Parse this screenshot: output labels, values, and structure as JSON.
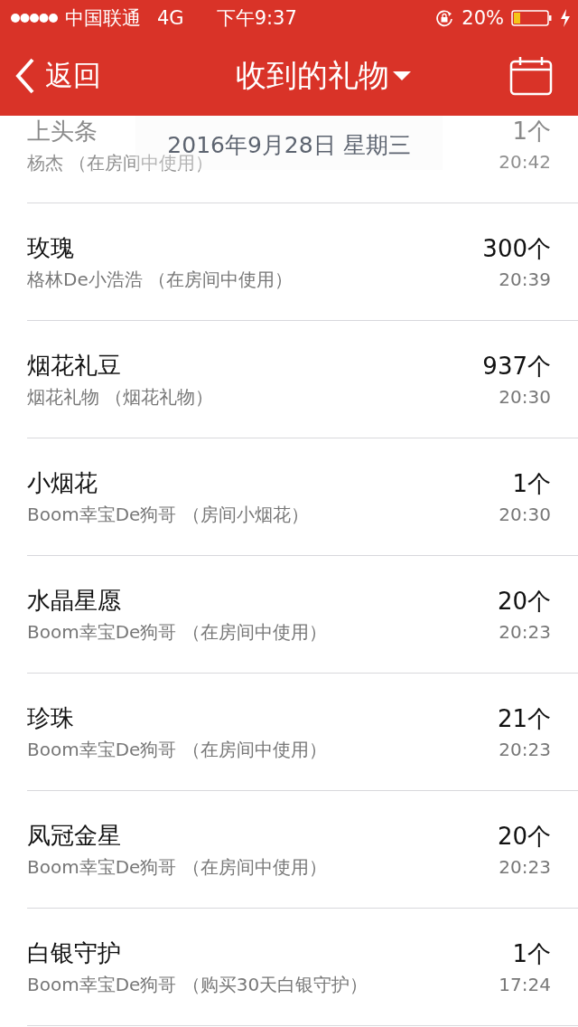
{
  "status_bar": {
    "carrier": "中国联通",
    "network": "4G",
    "time": "下午9:37",
    "battery": "20%"
  },
  "nav": {
    "back": "返回",
    "title": "收到的礼物"
  },
  "section_header": "2016年9月28日 星期三",
  "gifts": [
    {
      "name": "上头条",
      "sender": "杨杰 （在房间中使用）",
      "count": "1个",
      "time": "20:42",
      "dimmed": true
    },
    {
      "name": "玫瑰",
      "sender": "格林De小浩浩 （在房间中使用）",
      "count": "300个",
      "time": "20:39",
      "dimmed": false
    },
    {
      "name": "烟花礼豆",
      "sender": "烟花礼物 （烟花礼物）",
      "count": "937个",
      "time": "20:30",
      "dimmed": false
    },
    {
      "name": "小烟花",
      "sender": "Boom幸宝De狗哥 （房间小烟花）",
      "count": "1个",
      "time": "20:30",
      "dimmed": false
    },
    {
      "name": "水晶星愿",
      "sender": "Boom幸宝De狗哥 （在房间中使用）",
      "count": "20个",
      "time": "20:23",
      "dimmed": false
    },
    {
      "name": "珍珠",
      "sender": "Boom幸宝De狗哥 （在房间中使用）",
      "count": "21个",
      "time": "20:23",
      "dimmed": false
    },
    {
      "name": "凤冠金星",
      "sender": "Boom幸宝De狗哥 （在房间中使用）",
      "count": "20个",
      "time": "20:23",
      "dimmed": false
    },
    {
      "name": "白银守护",
      "sender": "Boom幸宝De狗哥 （购买30天白银守护）",
      "count": "1个",
      "time": "17:24",
      "dimmed": false
    }
  ]
}
